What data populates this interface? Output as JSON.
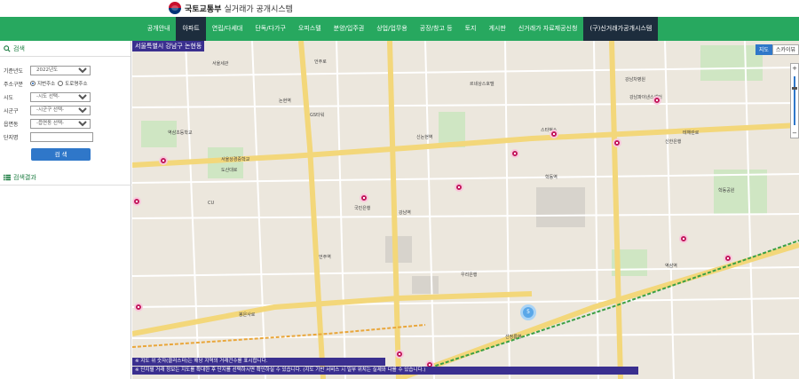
{
  "header": {
    "logo_main": "국토교통부",
    "logo_sub": "실거래가 공개시스템"
  },
  "nav": {
    "items": [
      "공개안내",
      "아파트",
      "연립/다세대",
      "단독/다가구",
      "오피스텔",
      "분양/입주권",
      "상업/업무용",
      "공장/창고 등",
      "토지",
      "게시판",
      "신거래가 자료제공신청",
      "(구)신거래가공개시스템"
    ]
  },
  "sidebar": {
    "search_title": "검색",
    "fields": {
      "period_label": "기준년도",
      "period_value": "2022년도",
      "search_type_label": "주소구분",
      "radio_jibun": "지번주소",
      "radio_road": "도로명주소",
      "sido_label": "시도",
      "sido_value": "-시도 선택-",
      "sigungu_label": "시군구",
      "sigungu_value": "-시군구 선택-",
      "dong_label": "읍면동",
      "dong_value": "-읍면동 선택-",
      "danji_label": "단지명"
    },
    "search_button": "검 색",
    "result_title": "검색결과"
  },
  "map": {
    "location_label": "서울특별시 강남구 논현동",
    "map_type_map": "지도",
    "map_type_sky": "스카이뷰",
    "zoom_plus": "+",
    "zoom_minus": "−",
    "cluster_count": "5",
    "notice_1": "※ 지도 위 숫자(클러스터)는 해당 지역의 거래건수를 표시합니다.",
    "notice_2": "※ 단지별 거래 정보는 지도를 확대한 후 단지를 선택하시면 확인하실 수 있습니다. (지도 기반 서비스 시 일부 위치는 실제와 다를 수 있습니다.)",
    "pois": [
      "서울세관",
      "논현역",
      "신논현역",
      "강남역",
      "학동역",
      "언주역",
      "선정릉역",
      "역삼역",
      "GS타워",
      "르네상스호텔",
      "강남파이낸스센터",
      "역삼초등학교",
      "서울상경중학교",
      "학동공원",
      "CU",
      "스타벅스",
      "국민은행",
      "신한은행",
      "우리은행",
      "강남차병원",
      "도산대로",
      "테헤란로",
      "봉은사로",
      "언주로"
    ]
  }
}
